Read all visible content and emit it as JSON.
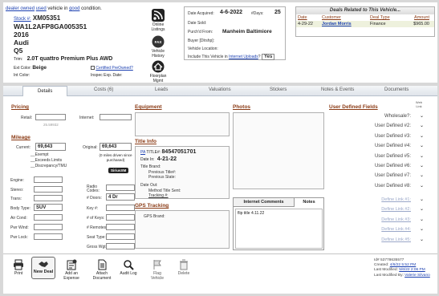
{
  "header": {
    "status_word": "dealer owned",
    "status_rest": "used",
    "status_suffix": "vehicle in",
    "condition": "good",
    "condition_suffix": "condition.",
    "stock_label": "Stock #:",
    "stock_no": "XM05351",
    "vin": "WA1L2AFP8GA005351",
    "year": "2016",
    "make": "Audi",
    "model": "Q5",
    "trim_label": "Trim:",
    "trim": "2.0T quattro Premium Plus  AWD",
    "ext_color_label": "Ext Color:",
    "ext_color": "Beige",
    "int_color_label": "Int Color:",
    "certified_label": "Certified PreOwned?",
    "inspec_label": "Inspec Exp. Date:"
  },
  "vehicle_icons": {
    "online": "Online Listings",
    "history": "Vehicle History",
    "floorplan": "Floorplan Mgmt"
  },
  "acquisition": {
    "date_acquired_label": "Date Acquired:",
    "date_acquired": "4-6-2022",
    "days_label": "#Days:",
    "days": "25",
    "date_sold_label": "Date Sold:",
    "purch_from_label": "Purch'd From:",
    "purch_from": "Manheim Baltimiore",
    "buyer_label": "Buyer [Dlrshp]:",
    "location_label": "Vehicle Location:",
    "include_prefix": "Include This Vehicle in",
    "include_link": "Internet Uploads",
    "include_q": "?",
    "include_value": "Yes"
  },
  "deals": {
    "title": "Deals Related to This Vehicle...",
    "headers": [
      "Date",
      "Customer",
      "Deal Type",
      "Amount"
    ],
    "rows": [
      {
        "date": "4-29-22",
        "customer": "Jordan  Morris",
        "type": "Finance",
        "amount": "$965.00"
      }
    ]
  },
  "tabs": [
    "Details",
    "Costs (6)",
    "Leads",
    "Valuations",
    "Stickers",
    "Notes & Events",
    "Documents"
  ],
  "pricing": {
    "title": "Pricing",
    "retail_label": "Retail:",
    "internet_label": "Internet:",
    "hint": "25.59932"
  },
  "mileage": {
    "title": "Mileage",
    "current_label": "Current:",
    "current": "69,643",
    "original_label": "Original:",
    "original": "69,643",
    "original_note": "(0 miles driven since purchased)",
    "exempt": "Exempt",
    "exceeds": "Exceeds Limits",
    "discrepancy": "Discrepancy/TMU",
    "siriusxm": "SiriusXM"
  },
  "specs": {
    "engine": "Engine:",
    "stereo": "Stereo:",
    "radio_codes": "Radio Codes:",
    "trans": "Trans:",
    "doors_label": "# Doors:",
    "doors": "4 Dr",
    "body_type_label": "Body Type:",
    "body_type": "SUV",
    "key": "Key #:",
    "air_cond": "Air Cond:",
    "keys_count": "# of Keys:",
    "pwr_wind": "Pwr Wind:",
    "remotes": "# Remotes:",
    "pwr_lock": "Pwr Lock:",
    "seat_type": "Seat Type:",
    "gross_wgt": "Gross Wgt:"
  },
  "equipment": {
    "title": "Equipment"
  },
  "title_info": {
    "title": "Title Info",
    "pa_label": "PA",
    "title_num_label": "TITLE#:",
    "title_num": "84547051701",
    "date_in_label": "Date In:",
    "date_in": "4-21-22",
    "brand_label": "Title Brand:",
    "prev_title": "Previous Title#:",
    "prev_state": "Previous State:",
    "date_out_label": "Date Out:",
    "method_label": "Method Title Sent:",
    "tracking": "Tracking #:"
  },
  "gps": {
    "title": "GPS Tracking",
    "brand_label": "GPS Brand:"
  },
  "photos": {
    "title": "Photos"
  },
  "comments": {
    "tabs": [
      "Internet Comments",
      "Notes"
    ],
    "note": "flip title 4.11.22"
  },
  "udf": {
    "title": "User Defined Fields",
    "fields": [
      "Wholesale?:",
      "User Defined #2:",
      "User Defined #3:",
      "User Defined #4:",
      "User Defined #5:",
      "User Defined #6:",
      "User Defined #7:",
      "User Defined #8:"
    ],
    "links": [
      "Define Link #1:",
      "Define Link #2:",
      "Define Link #3:",
      "Define Link #4:",
      "Define Link #5:"
    ],
    "web_link": "Web Link"
  },
  "toolbar": [
    "Print",
    "New Deal",
    "Add an Expense",
    "Attach Document",
    "Audit Log",
    "Flag Vehicle",
    "Delete"
  ],
  "meta": {
    "id": "Id# 53778635577",
    "created_label": "Created:",
    "created": "4/6/22 5:52 PM",
    "modified_label": "Last Modified:",
    "modified": "5/6/22 2:06 PM",
    "modified_by_label": "Last Modified By:",
    "modified_by": "Valerie Silvano"
  }
}
